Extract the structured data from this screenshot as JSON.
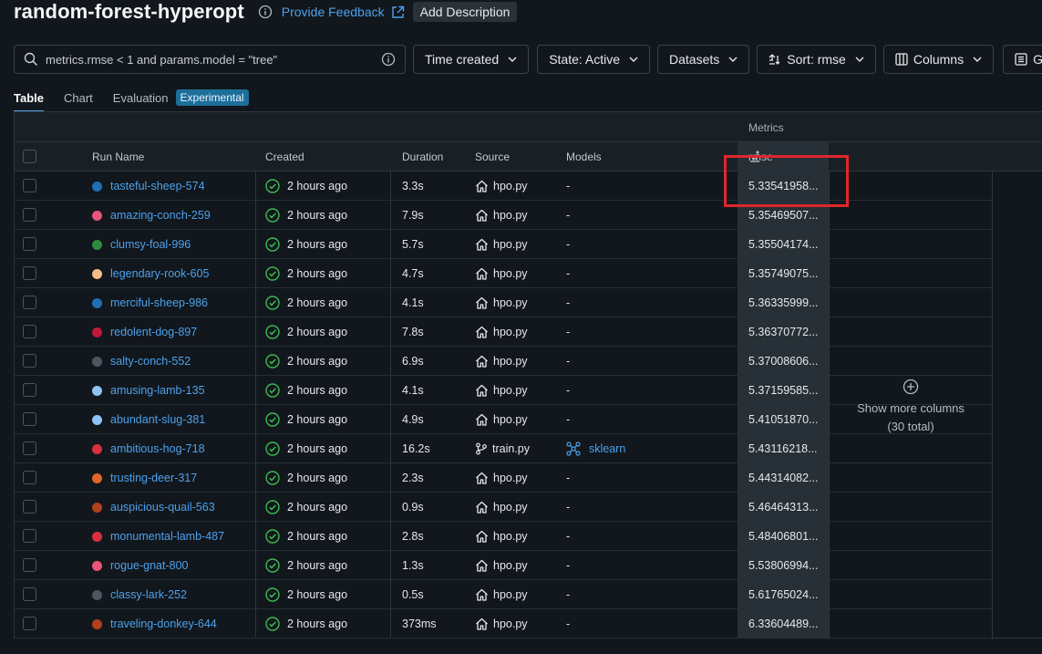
{
  "header": {
    "title": "random-forest-hyperopt",
    "feedback_label": "Provide Feedback",
    "add_description_label": "Add Description"
  },
  "toolbar": {
    "search_value": "metrics.rmse < 1 and params.model = \"tree\"",
    "time_created_label": "Time created",
    "state_label": "State: Active",
    "datasets_label": "Datasets",
    "sort_label": "Sort: rmse",
    "columns_label": "Columns",
    "group_label": "Group"
  },
  "tabs": {
    "table": "Table",
    "chart": "Chart",
    "evaluation": "Evaluation",
    "experimental": "Experimental"
  },
  "grid": {
    "metrics_group": "Metrics",
    "columns": {
      "run_name": "Run Name",
      "created": "Created",
      "duration": "Duration",
      "source": "Source",
      "models": "Models",
      "rmse": "rmse"
    },
    "show_more_line1": "Show more columns",
    "show_more_line2": "(30 total)",
    "rows": [
      {
        "name": "tasteful-sheep-574",
        "color": "#1f6fb2",
        "created": "2 hours ago",
        "duration": "3.3s",
        "source": "hpo.py",
        "source_icon": "home-icon",
        "model": "-",
        "rmse": "5.33541958..."
      },
      {
        "name": "amazing-conch-259",
        "color": "#e7557a",
        "created": "2 hours ago",
        "duration": "7.9s",
        "source": "hpo.py",
        "source_icon": "home-icon",
        "model": "-",
        "rmse": "5.35469507..."
      },
      {
        "name": "clumsy-foal-996",
        "color": "#2e8b3e",
        "created": "2 hours ago",
        "duration": "5.7s",
        "source": "hpo.py",
        "source_icon": "home-icon",
        "model": "-",
        "rmse": "5.35504174..."
      },
      {
        "name": "legendary-rook-605",
        "color": "#f2bd8a",
        "created": "2 hours ago",
        "duration": "4.7s",
        "source": "hpo.py",
        "source_icon": "home-icon",
        "model": "-",
        "rmse": "5.35749075..."
      },
      {
        "name": "merciful-sheep-986",
        "color": "#1f6fb2",
        "created": "2 hours ago",
        "duration": "4.1s",
        "source": "hpo.py",
        "source_icon": "home-icon",
        "model": "-",
        "rmse": "5.36335999..."
      },
      {
        "name": "redolent-dog-897",
        "color": "#c0183a",
        "created": "2 hours ago",
        "duration": "7.8s",
        "source": "hpo.py",
        "source_icon": "home-icon",
        "model": "-",
        "rmse": "5.36370772..."
      },
      {
        "name": "salty-conch-552",
        "color": "#4c5660",
        "created": "2 hours ago",
        "duration": "6.9s",
        "source": "hpo.py",
        "source_icon": "home-icon",
        "model": "-",
        "rmse": "5.37008606..."
      },
      {
        "name": "amusing-lamb-135",
        "color": "#8ec3f5",
        "created": "2 hours ago",
        "duration": "4.1s",
        "source": "hpo.py",
        "source_icon": "home-icon",
        "model": "-",
        "rmse": "5.37159585..."
      },
      {
        "name": "abundant-slug-381",
        "color": "#8ec3f5",
        "created": "2 hours ago",
        "duration": "4.9s",
        "source": "hpo.py",
        "source_icon": "home-icon",
        "model": "-",
        "rmse": "5.41051870..."
      },
      {
        "name": "ambitious-hog-718",
        "color": "#d8303f",
        "created": "2 hours ago",
        "duration": "16.2s",
        "source": "train.py",
        "source_icon": "branch-icon",
        "model": "sklearn",
        "rmse": "5.43116218..."
      },
      {
        "name": "trusting-deer-317",
        "color": "#e0642a",
        "created": "2 hours ago",
        "duration": "2.3s",
        "source": "hpo.py",
        "source_icon": "home-icon",
        "model": "-",
        "rmse": "5.44314082..."
      },
      {
        "name": "auspicious-quail-563",
        "color": "#b3401e",
        "created": "2 hours ago",
        "duration": "0.9s",
        "source": "hpo.py",
        "source_icon": "home-icon",
        "model": "-",
        "rmse": "5.46464313..."
      },
      {
        "name": "monumental-lamb-487",
        "color": "#d8303f",
        "created": "2 hours ago",
        "duration": "2.8s",
        "source": "hpo.py",
        "source_icon": "home-icon",
        "model": "-",
        "rmse": "5.48406801..."
      },
      {
        "name": "rogue-gnat-800",
        "color": "#e7557a",
        "created": "2 hours ago",
        "duration": "1.3s",
        "source": "hpo.py",
        "source_icon": "home-icon",
        "model": "-",
        "rmse": "5.53806994..."
      },
      {
        "name": "classy-lark-252",
        "color": "#4c5660",
        "created": "2 hours ago",
        "duration": "0.5s",
        "source": "hpo.py",
        "source_icon": "home-icon",
        "model": "-",
        "rmse": "5.61765024..."
      },
      {
        "name": "traveling-donkey-644",
        "color": "#b3401e",
        "created": "2 hours ago",
        "duration": "373ms",
        "source": "hpo.py",
        "source_icon": "home-icon",
        "model": "-",
        "rmse": "6.33604489..."
      }
    ]
  },
  "colors": {
    "accent": "#4ea0ec",
    "highlight_box": "#e0262b",
    "success": "#3fb950"
  }
}
